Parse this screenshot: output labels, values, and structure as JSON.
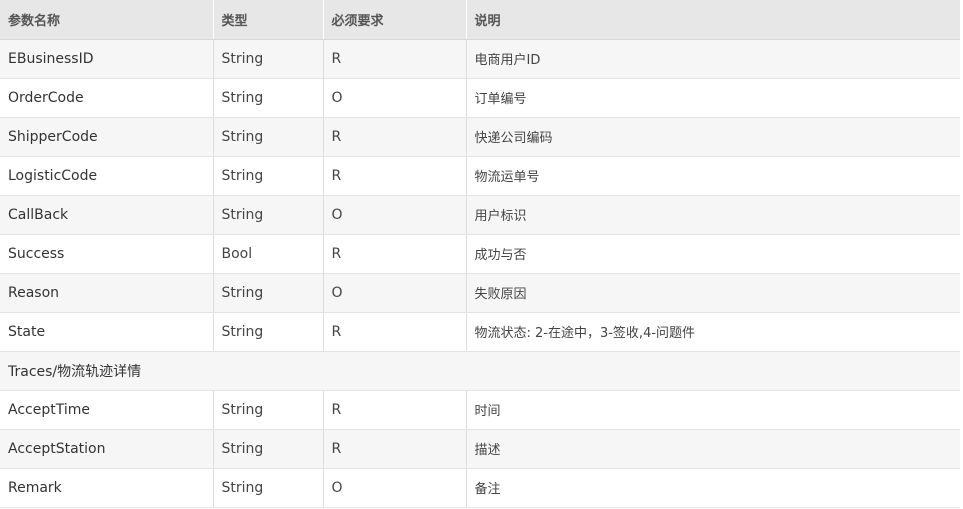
{
  "header": {
    "col_name": "参数名称",
    "col_type": "类型",
    "col_required": "必须要求",
    "col_desc": "说明"
  },
  "rows": [
    {
      "name": "EBusinessID",
      "type": "String",
      "required": "R",
      "desc": "电商用户ID"
    },
    {
      "name": "OrderCode",
      "type": "String",
      "required": "O",
      "desc": "订单编号"
    },
    {
      "name": "ShipperCode",
      "type": "String",
      "required": "R",
      "desc": "快递公司编码"
    },
    {
      "name": "LogisticCode",
      "type": "String",
      "required": "R",
      "desc": "物流运单号"
    },
    {
      "name": "CallBack",
      "type": "String",
      "required": "O",
      "desc": "用户标识"
    },
    {
      "name": "Success",
      "type": "Bool",
      "required": "R",
      "desc": "成功与否"
    },
    {
      "name": "Reason",
      "type": "String",
      "required": "O",
      "desc": "失败原因"
    },
    {
      "name": "State",
      "type": "String",
      "required": "R",
      "desc": "物流状态: 2-在途中，3-签收,4-问题件"
    }
  ],
  "section": {
    "label": "Traces/物流轨迹详情"
  },
  "trace_rows": [
    {
      "name": "AcceptTime",
      "type": "String",
      "required": "R",
      "desc": "时间"
    },
    {
      "name": "AcceptStation",
      "type": "String",
      "required": "R",
      "desc": "描述"
    },
    {
      "name": "Remark",
      "type": "String",
      "required": "O",
      "desc": "备注"
    }
  ]
}
